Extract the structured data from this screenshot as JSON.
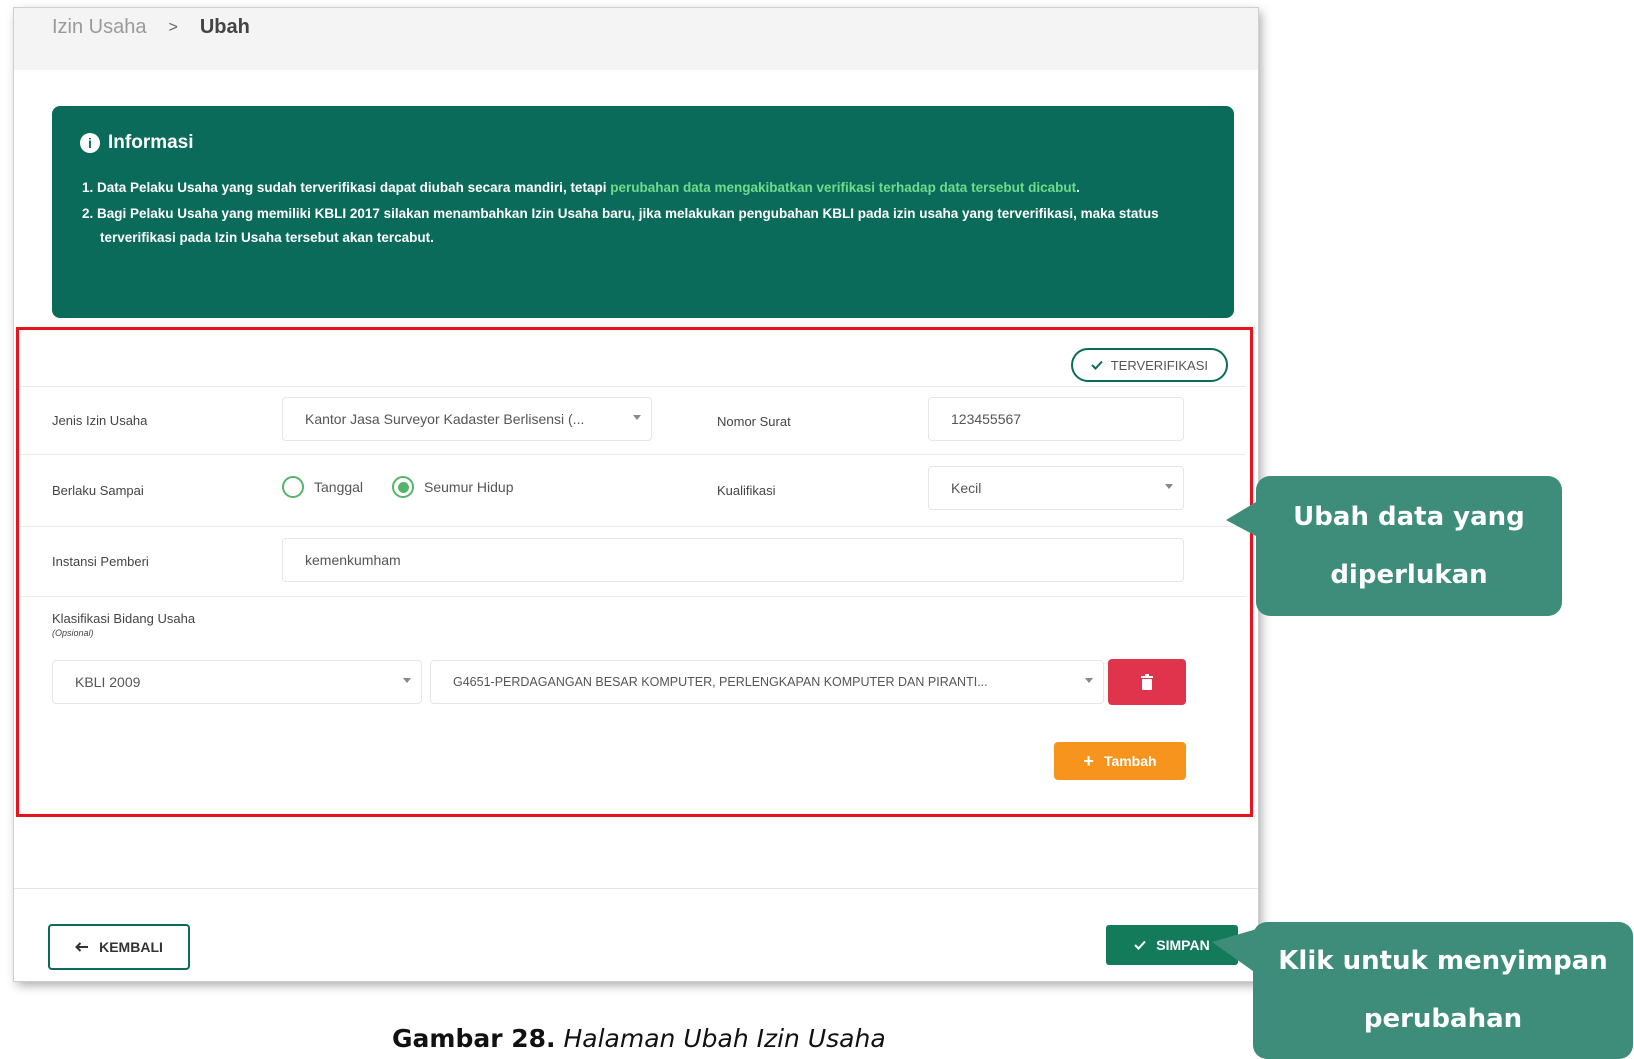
{
  "breadcrumb": {
    "parent": "Izin Usaha",
    "separator": ">",
    "current": "Ubah"
  },
  "info": {
    "title": "Informasi",
    "line1_prefix": "1. Data Pelaku Usaha yang sudah terverifikasi dapat diubah secara mandiri, tetapi ",
    "line1_highlight": "perubahan data mengakibatkan verifikasi terhadap data tersebut dicabut",
    "line1_suffix": ".",
    "line2": "2. Bagi Pelaku Usaha yang memiliki KBLI 2017 silakan menambahkan Izin Usaha baru, jika melakukan pengubahan KBLI pada izin usaha yang terverifikasi, maka status terverifikasi pada Izin Usaha tersebut akan tercabut."
  },
  "status_badge": "TERVERIFIKASI",
  "form": {
    "jenis_label": "Jenis Izin Usaha",
    "jenis_value": "Kantor Jasa Surveyor Kadaster Berlisensi (...",
    "nomor_label": "Nomor Surat",
    "nomor_value": "123455567",
    "berlaku_label": "Berlaku Sampai",
    "radio_tanggal": "Tanggal",
    "radio_seumur": "Seumur Hidup",
    "kualifikasi_label": "Kualifikasi",
    "kualifikasi_value": "Kecil",
    "instansi_label": "Instansi Pemberi",
    "instansi_value": "kemenkumham",
    "klasifikasi_label": "Klasifikasi Bidang Usaha",
    "klasifikasi_optional": "(Opsional)",
    "kbli_version": "KBLI 2009",
    "kbli_code": "G4651-PERDAGANGAN BESAR KOMPUTER, PERLENGKAPAN KOMPUTER DAN PIRANTI...",
    "tambah_label": "Tambah"
  },
  "footer": {
    "back_label": "KEMBALI",
    "save_label": "SIMPAN"
  },
  "callouts": {
    "edit_line1": "Ubah data yang",
    "edit_line2": "diperlukan",
    "save_line1": "Klik untuk menyimpan",
    "save_line2": "perubahan"
  },
  "caption": {
    "number": "Gambar 28.",
    "title": "Halaman Ubah Izin Usaha"
  },
  "colors": {
    "primary": "#0b6b5a",
    "danger": "#e0344d",
    "warning": "#f7941d",
    "callout": "#3d8d7a",
    "highlight_box": "#e8131c"
  }
}
